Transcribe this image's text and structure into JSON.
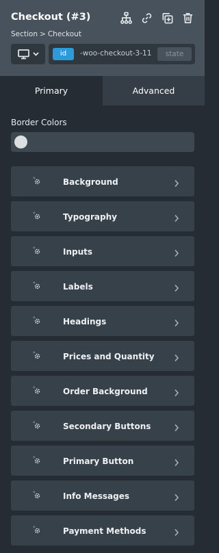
{
  "header": {
    "title": "Checkout (#3)",
    "breadcrumb": [
      "Section",
      "Checkout"
    ],
    "breadcrumb_separator": ">",
    "tool_icons": [
      "structure-icon",
      "link-icon",
      "duplicate-icon",
      "trash-icon"
    ]
  },
  "selector": {
    "device_icon": "desktop-icon",
    "tag": "id",
    "value": "-woo-checkout-3-11",
    "state_label": "state"
  },
  "tabs": [
    {
      "label": "Primary",
      "active": true
    },
    {
      "label": "Advanced",
      "active": false
    }
  ],
  "border_colors": {
    "label": "Border Colors",
    "swatch_color": "#dcdfe2"
  },
  "groups": [
    {
      "label": "Background"
    },
    {
      "label": "Typography"
    },
    {
      "label": "Inputs"
    },
    {
      "label": "Labels"
    },
    {
      "label": "Headings"
    },
    {
      "label": "Prices and Quantity"
    },
    {
      "label": "Order Background"
    },
    {
      "label": "Secondary Buttons"
    },
    {
      "label": "Primary Button"
    },
    {
      "label": "Info Messages"
    },
    {
      "label": "Payment Methods"
    }
  ],
  "colors": {
    "header_bg": "#47525c",
    "panel_bg": "#252c33",
    "accent": "#2d9ad9",
    "group_bg": "#37414a"
  }
}
